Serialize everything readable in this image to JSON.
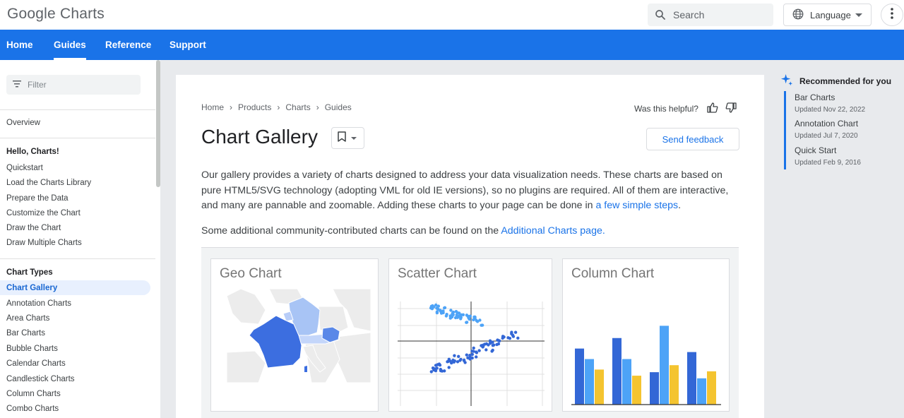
{
  "header": {
    "logo": "Google Charts",
    "search_placeholder": "Search",
    "language_label": "Language"
  },
  "nav": {
    "items": [
      "Home",
      "Guides",
      "Reference",
      "Support"
    ],
    "active": "Guides"
  },
  "sidebar": {
    "filter_placeholder": "Filter",
    "overview": "Overview",
    "section1_heading": "Hello, Charts!",
    "section1_items": [
      "Quickstart",
      "Load the Charts Library",
      "Prepare the Data",
      "Customize the Chart",
      "Draw the Chart",
      "Draw Multiple Charts"
    ],
    "section2_heading": "Chart Types",
    "section2_items": [
      "Chart Gallery",
      "Annotation Charts",
      "Area Charts",
      "Bar Charts",
      "Bubble Charts",
      "Calendar Charts",
      "Candlestick Charts",
      "Column Charts",
      "Combo Charts"
    ],
    "active_item": "Chart Gallery"
  },
  "breadcrumb": [
    "Home",
    "Products",
    "Charts",
    "Guides"
  ],
  "helpful": "Was this helpful?",
  "page_title": "Chart Gallery",
  "send_feedback": "Send feedback",
  "intro": {
    "text": "Our gallery provides a variety of charts designed to address your data visualization needs. These charts are based on pure HTML5/SVG technology (adopting VML for old IE versions), so no plugins are required. All of them are interactive, and many are pannable and zoomable. Adding these charts to your page can be done in ",
    "link": "a few simple steps",
    "tail": "."
  },
  "community": {
    "text": "Some additional community-contributed charts can be found on the ",
    "link": "Additional Charts page."
  },
  "gallery": {
    "tiles": [
      "Geo Chart",
      "Scatter Chart",
      "Column Chart"
    ]
  },
  "recommended": {
    "title": "Recommended for you",
    "items": [
      {
        "name": "Bar Charts",
        "updated": "Updated Nov 22, 2022"
      },
      {
        "name": "Annotation Chart",
        "updated": "Updated Jul 7, 2020"
      },
      {
        "name": "Quick Start",
        "updated": "Updated Feb 9, 2016"
      }
    ]
  },
  "colors": {
    "brand_blue": "#1a73e8",
    "series_dark_blue": "#3367d6",
    "series_light_blue": "#4da3f7",
    "series_yellow": "#f4c430"
  }
}
